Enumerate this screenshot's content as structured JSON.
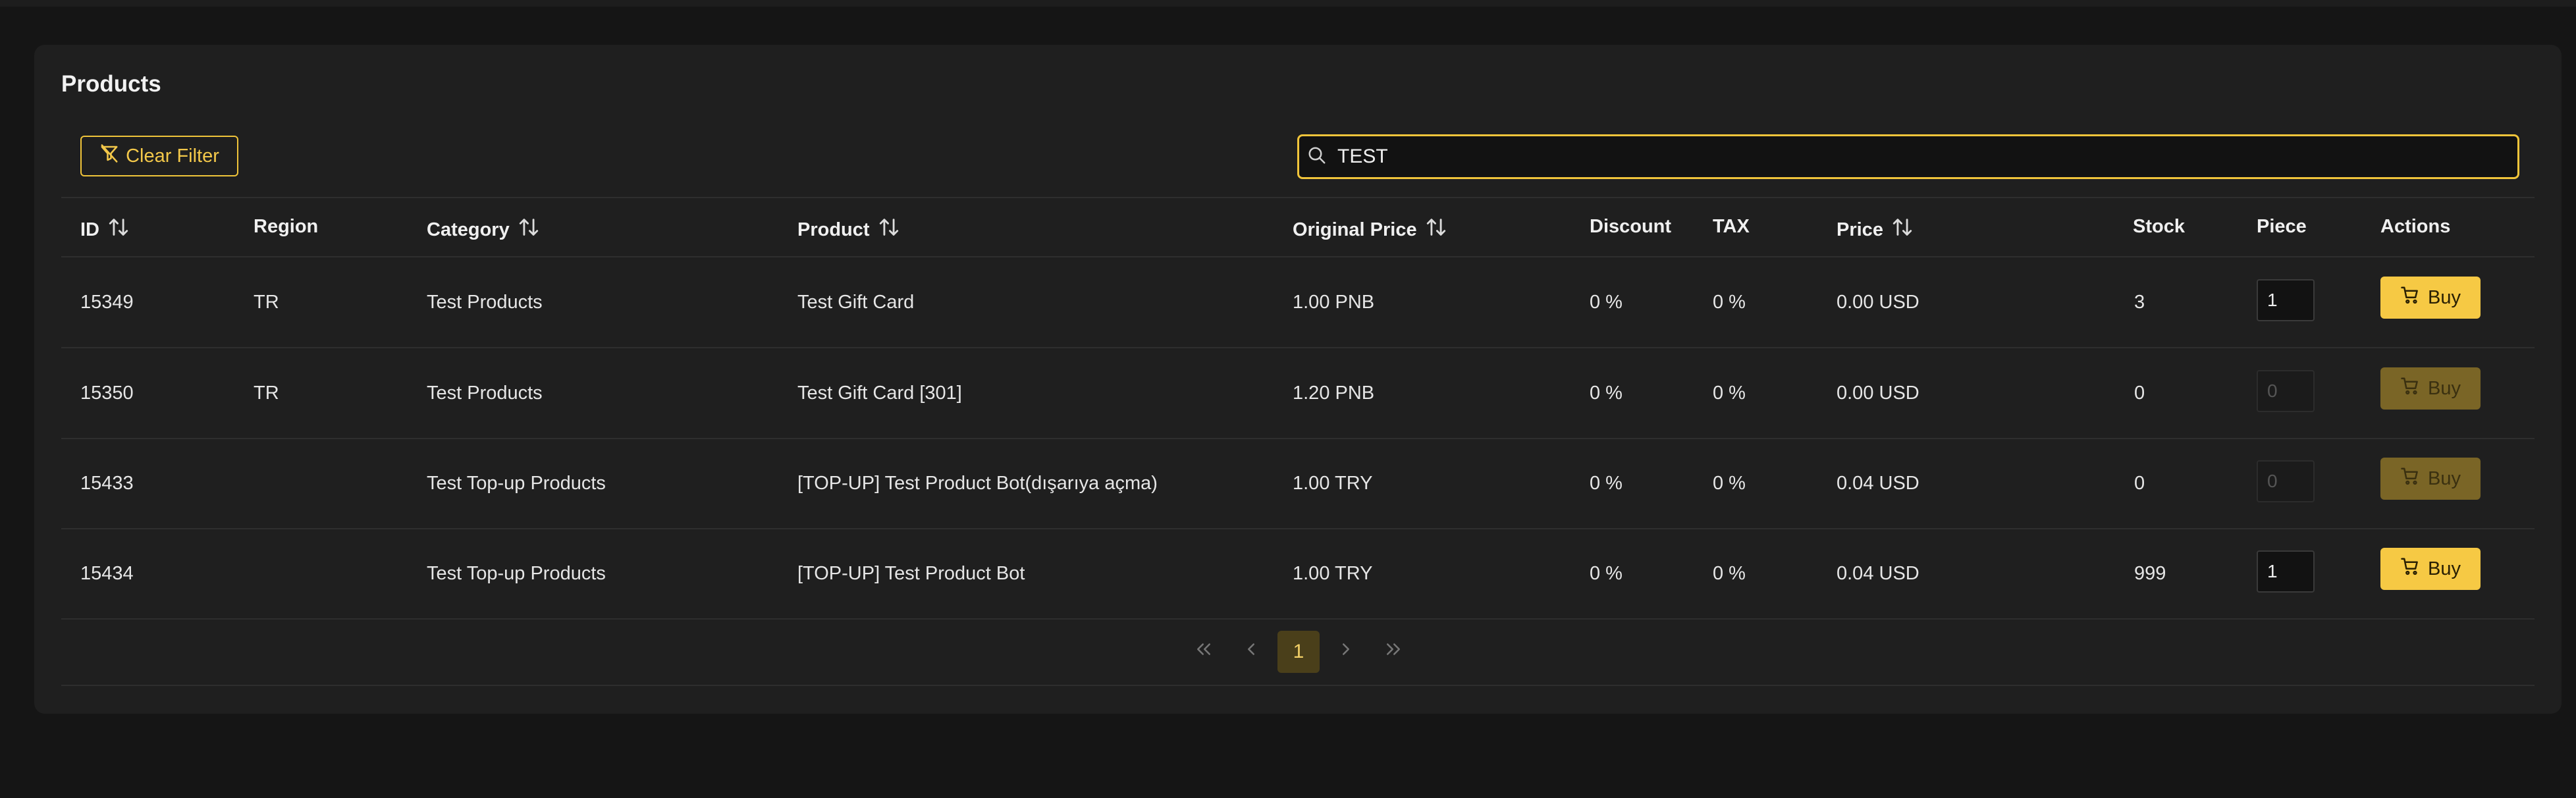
{
  "panel": {
    "title": "Products"
  },
  "toolbar": {
    "clear_filter_label": "Clear Filter",
    "search_value": "TEST"
  },
  "columns": {
    "id": "ID",
    "region": "Region",
    "category": "Category",
    "product": "Product",
    "original_price": "Original Price",
    "discount": "Discount",
    "tax": "TAX",
    "price": "Price",
    "stock": "Stock",
    "piece": "Piece",
    "actions": "Actions"
  },
  "rows": [
    {
      "id": "15349",
      "region": "TR",
      "category": "Test Products",
      "product": "Test Gift Card",
      "original_price": "1.00 PNB",
      "discount": "0 %",
      "tax": "0 %",
      "price": "0.00 USD",
      "stock": "3",
      "piece": "1",
      "buy_label": "Buy",
      "enabled": true
    },
    {
      "id": "15350",
      "region": "TR",
      "category": "Test Products",
      "product": "Test Gift Card [301]",
      "original_price": "1.20 PNB",
      "discount": "0 %",
      "tax": "0 %",
      "price": "0.00 USD",
      "stock": "0",
      "piece": "0",
      "buy_label": "Buy",
      "enabled": false
    },
    {
      "id": "15433",
      "region": "",
      "category": "Test Top-up Products",
      "product": "[TOP-UP] Test Product Bot(dışarıya açma)",
      "original_price": "1.00 TRY",
      "discount": "0 %",
      "tax": "0 %",
      "price": "0.04 USD",
      "stock": "0",
      "piece": "0",
      "buy_label": "Buy",
      "enabled": false
    },
    {
      "id": "15434",
      "region": "",
      "category": "Test Top-up Products",
      "product": "[TOP-UP] Test Product Bot",
      "original_price": "1.00 TRY",
      "discount": "0 %",
      "tax": "0 %",
      "price": "0.04 USD",
      "stock": "999",
      "piece": "1",
      "buy_label": "Buy",
      "enabled": true
    }
  ],
  "pagination": {
    "current_page": "1"
  },
  "colors": {
    "accent": "#f6c944",
    "accent_disabled": "#7a6526",
    "panel_bg": "#1f1f1f",
    "page_bg": "#151515"
  },
  "icons": {
    "clear_filter": "filter-slash-icon",
    "search": "search-icon",
    "sort": "sort-arrows-icon",
    "buy": "cart-icon",
    "first": "double-chevron-left-icon",
    "prev": "chevron-left-icon",
    "next": "chevron-right-icon",
    "last": "double-chevron-right-icon"
  }
}
